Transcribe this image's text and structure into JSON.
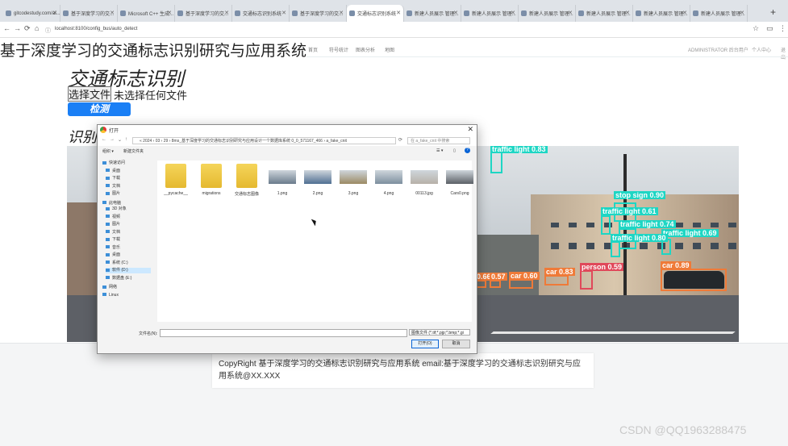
{
  "browser": {
    "tabs": [
      {
        "label": "gitcodestudy.com/ai..."
      },
      {
        "label": "基于深度学习的交..."
      },
      {
        "label": "Microsoft C++ 生成..."
      },
      {
        "label": "基于深度学习的交..."
      },
      {
        "label": "交通标志识别系统"
      },
      {
        "label": "基于深度学习的交..."
      },
      {
        "label": "交通标志识别系统"
      },
      {
        "label": "新建人员展示 管理..."
      },
      {
        "label": "新建人员展示 管理..."
      },
      {
        "label": "新建人员展示 管理..."
      },
      {
        "label": "新建人员展示 管理..."
      },
      {
        "label": "新建人员展示 管理..."
      },
      {
        "label": "新建人员展示 管理..."
      }
    ],
    "active_tab_index": 6,
    "url": "localhost:8100/config_bus/auto_detect"
  },
  "header": {
    "title": "基于深度学习的交通标志识别研究与应用系统",
    "nav": [
      "首页",
      "符号统计",
      "图表分析",
      "地图"
    ],
    "right_nav": [
      "ADMINISTRATOR 后台用户",
      "个人中心",
      "退出"
    ]
  },
  "main": {
    "title": "交通标志识别",
    "file_button": "选择文件",
    "file_status": "未选择任何文件",
    "detect_button": "检测",
    "result_title": "识别"
  },
  "detections": [
    {
      "label": "traffic light 0.83",
      "color": "#1ed6c4"
    },
    {
      "label": "stop sign 0.90",
      "color": "#1ed6c4"
    },
    {
      "label": "traffic light 0.61",
      "color": "#1ed6c4"
    },
    {
      "label": "traffic light 0.74",
      "color": "#1ed6c4"
    },
    {
      "label": "traffic light 0.69",
      "color": "#1ed6c4"
    },
    {
      "label": "traffic light 0.80",
      "color": "#1ed6c4"
    },
    {
      "label": "person 0.59",
      "color": "#e0485a"
    },
    {
      "label": "car 0.89",
      "color": "#ef7a38"
    },
    {
      "label": "car 0.60",
      "color": "#ef7a38"
    },
    {
      "label": "car 0.83",
      "color": "#ef7a38"
    },
    {
      "label": "0.66",
      "color": "#ef7a38"
    },
    {
      "label": "0.57",
      "color": "#ef7a38"
    }
  ],
  "footer": {
    "copyright": "CopyRight 基于深度学习的交通标志识别研究与应用系统 email:基于深度学习的交通标志识别研究与应用系统@XX.XXX"
  },
  "watermark": "CSDN @QQ1963288475",
  "dialog": {
    "title": "打开",
    "path": "« 2024 › 03 › 29 › 8ms_基于深度学习的交通标志识别研究与应用设计一个数据库系统 0_0_571167_466 › a_fake_cnit",
    "search_placeholder": "在 a_fake_cnit 中搜索",
    "toolbar": {
      "organize": "组织 ▾",
      "new_folder": "新建文件夹"
    },
    "sidebar": [
      "快速访问",
      "桌面",
      "下载",
      "文档",
      "图片",
      "此电脑",
      "3D 对象",
      "视频",
      "图片",
      "文档",
      "下载",
      "音乐",
      "桌面",
      "系统 (C:)",
      "软件 (D:)",
      "数据盘 (E:)",
      "网络",
      "Linux"
    ],
    "selected_sidebar_index": 14,
    "files": [
      {
        "name": "__pycache__",
        "kind": "folder"
      },
      {
        "name": "migrations",
        "kind": "folder"
      },
      {
        "name": "交通标志图像",
        "kind": "folder"
      },
      {
        "name": "1.png",
        "kind": "image"
      },
      {
        "name": "2.png",
        "kind": "image"
      },
      {
        "name": "3.png",
        "kind": "image"
      },
      {
        "name": "4.png",
        "kind": "image"
      },
      {
        "name": "00113.jpg",
        "kind": "image"
      },
      {
        "name": "Cars0.png",
        "kind": "image"
      }
    ],
    "filename_label": "文件名(N):",
    "filetype": "图像文件 (*.tif;*.pjp;*.bmp;*.gi",
    "open_button": "打开(O)",
    "cancel_button": "取消"
  }
}
